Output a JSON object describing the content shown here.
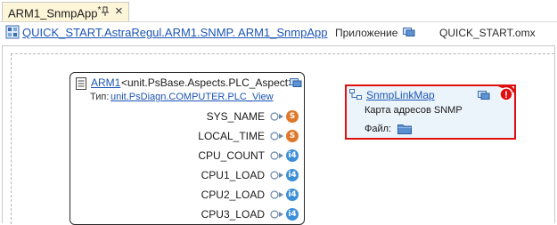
{
  "tab": {
    "title": "ARM1_SnmpApp",
    "modified_mark": "*",
    "pin_icon": "pin-icon",
    "close_glyph": "×"
  },
  "pathbar": {
    "path": "QUICK_START.AstraRegul.ARM1.SNMP. ARM1_SnmpApp",
    "kind": "Приложение",
    "file": "QUICK_START.omx"
  },
  "arm": {
    "name": "ARM1",
    "type": "<unit.PsBase.Aspects.PLC_Aspect>",
    "view_label": "Тип:",
    "view": "unit.PsDiagn.COMPUTER.PLC_View",
    "ports": [
      {
        "label": "SYS_NAME",
        "badge": "S",
        "kind": "string"
      },
      {
        "label": "LOCAL_TIME",
        "badge": "S",
        "kind": "string"
      },
      {
        "label": "CPU_COUNT",
        "badge": "i4",
        "kind": "int"
      },
      {
        "label": "CPU1_LOAD",
        "badge": "i4",
        "kind": "int"
      },
      {
        "label": "CPU2_LOAD",
        "badge": "i4",
        "kind": "int"
      },
      {
        "label": "CPU3_LOAD",
        "badge": "i4",
        "kind": "int"
      }
    ]
  },
  "snmp": {
    "name": "SnmpLinkMap",
    "description": "Карта адресов SNMP",
    "file_label": "Файл:",
    "error_badge": "!"
  },
  "colors": {
    "link": "#1c55b5",
    "string_badge": "#e0782b",
    "int_badge": "#3d8fd8",
    "error": "#e01010",
    "tab_active": "#fdf5d8",
    "block_fill": "#ebf4fb"
  }
}
